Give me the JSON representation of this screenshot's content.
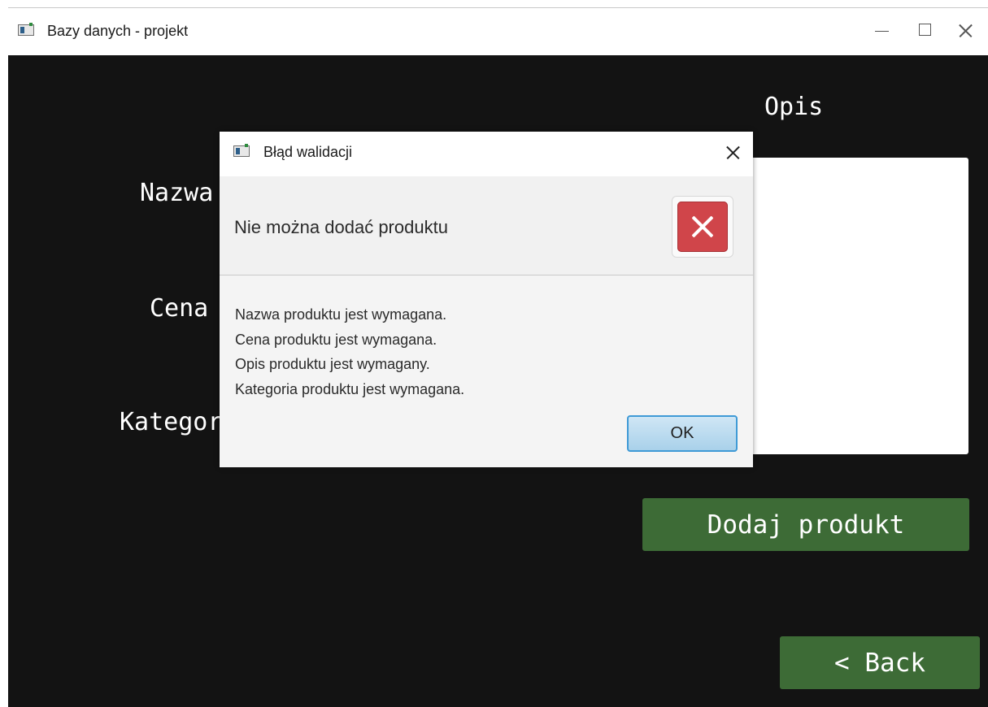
{
  "window": {
    "title": "Bazy danych - projekt",
    "controls": [
      "minimize-icon",
      "maximize-icon",
      "close-icon"
    ]
  },
  "form": {
    "label_nazwa": "Nazwa",
    "label_cena": "Cena",
    "label_kategoria": "Kategoria",
    "label_opis": "Opis",
    "opis_value": "",
    "add_button": "Dodaj produkt",
    "back_button": "< Back"
  },
  "dialog": {
    "title": "Błąd walidacji",
    "header": "Nie można dodać produktu",
    "messages": [
      "Nazwa produktu jest wymagana.",
      "Cena produktu jest wymagana.",
      "Opis produktu jest wymagany.",
      "Kategoria produktu jest wymagana."
    ],
    "ok_button": "OK",
    "icon": "error-icon"
  },
  "colors": {
    "background": "#131313",
    "button_green": "#3d6b36",
    "error_red": "#d0454a",
    "ok_border": "#3f9ad6"
  }
}
